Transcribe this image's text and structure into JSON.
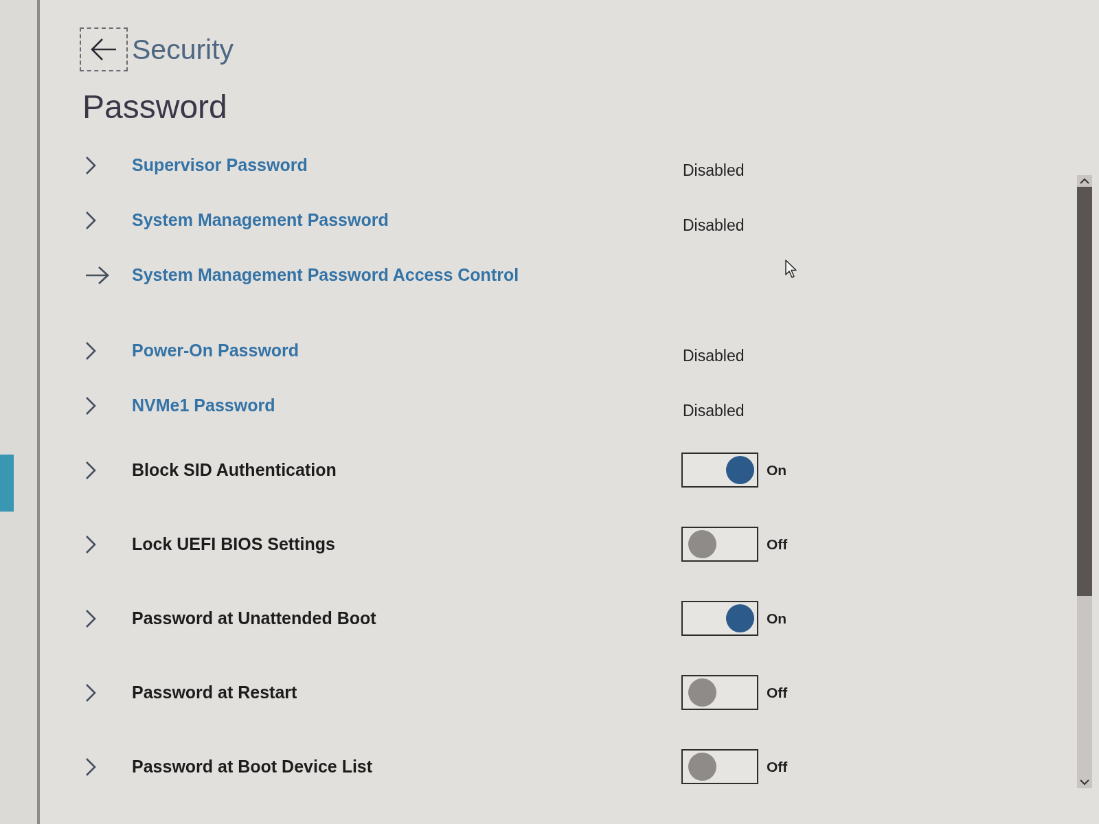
{
  "back_button": {
    "focused": true
  },
  "breadcrumb": "Security",
  "title": "Password",
  "settings": [
    {
      "kind": "submenu",
      "label": "Supervisor Password",
      "value": "Disabled"
    },
    {
      "kind": "submenu",
      "label": "System Management Password",
      "value": "Disabled"
    },
    {
      "kind": "action",
      "label": "System Management Password Access Control"
    },
    {
      "kind": "submenu",
      "label": "Power-On Password",
      "value": "Disabled"
    },
    {
      "kind": "submenu",
      "label": "NVMe1 Password",
      "value": "Disabled"
    },
    {
      "kind": "toggle",
      "label": "Block SID Authentication",
      "on": true,
      "value": "On"
    },
    {
      "kind": "toggle",
      "label": "Lock UEFI BIOS Settings",
      "on": false,
      "value": "Off"
    },
    {
      "kind": "toggle",
      "label": "Password at Unattended Boot",
      "on": true,
      "value": "On"
    },
    {
      "kind": "toggle",
      "label": "Password at Restart",
      "on": false,
      "value": "Off"
    },
    {
      "kind": "toggle",
      "label": "Password at Boot Device List",
      "on": false,
      "value": "Off"
    }
  ]
}
